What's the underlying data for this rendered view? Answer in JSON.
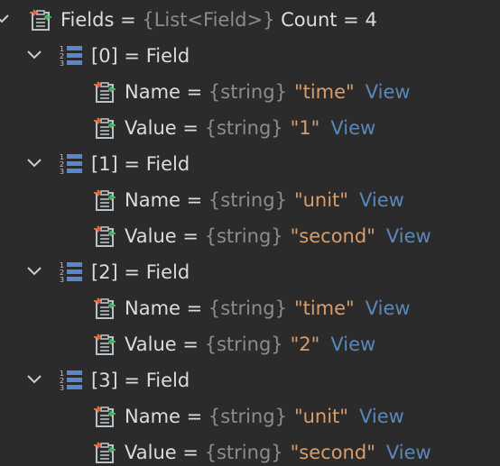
{
  "colors": {
    "background": "#2b2b2b",
    "text": "#dcdcdc",
    "type": "#8c8c8c",
    "string": "#d69d6d",
    "link": "#5b87b8"
  },
  "root": {
    "name": "Fields",
    "eq": " = ",
    "type": "{List<Field>}",
    "count_text": " Count = 4"
  },
  "items": [
    {
      "label": "[0] = Field",
      "props": [
        {
          "name": "Name",
          "eq": " = ",
          "type": "{string}",
          "value": "\"time\"",
          "view": "View"
        },
        {
          "name": "Value",
          "eq": " = ",
          "type": "{string}",
          "value": "\"1\"",
          "view": "View"
        }
      ]
    },
    {
      "label": "[1] = Field",
      "props": [
        {
          "name": "Name",
          "eq": " = ",
          "type": "{string}",
          "value": "\"unit\"",
          "view": "View"
        },
        {
          "name": "Value",
          "eq": " = ",
          "type": "{string}",
          "value": "\"second\"",
          "view": "View"
        }
      ]
    },
    {
      "label": "[2] = Field",
      "props": [
        {
          "name": "Name",
          "eq": " = ",
          "type": "{string}",
          "value": "\"time\"",
          "view": "View"
        },
        {
          "name": "Value",
          "eq": " = ",
          "type": "{string}",
          "value": "\"2\"",
          "view": "View"
        }
      ]
    },
    {
      "label": "[3] = Field",
      "props": [
        {
          "name": "Name",
          "eq": " = ",
          "type": "{string}",
          "value": "\"unit\"",
          "view": "View"
        },
        {
          "name": "Value",
          "eq": " = ",
          "type": "{string}",
          "value": "\"second\"",
          "view": "View"
        }
      ]
    }
  ]
}
